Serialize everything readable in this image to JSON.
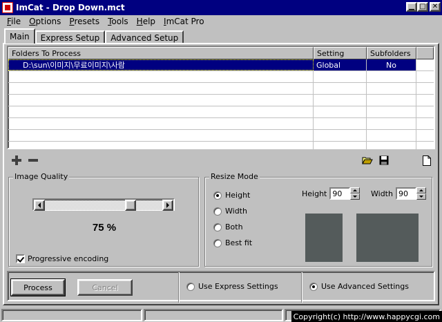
{
  "window": {
    "title": "ImCat - Drop Down.mct"
  },
  "menu": [
    {
      "label": "File",
      "underline": "F",
      "rest": "ile"
    },
    {
      "label": "Options",
      "underline": "O",
      "rest": "ptions"
    },
    {
      "label": "Presets",
      "underline": "P",
      "rest": "resets"
    },
    {
      "label": "Tools",
      "underline": "T",
      "rest": "ools"
    },
    {
      "label": "Help",
      "underline": "H",
      "rest": "elp"
    },
    {
      "label": "ImCat Pro",
      "underline": "I",
      "rest": "mCat Pro"
    }
  ],
  "tabs": [
    {
      "label": "Main",
      "active": true
    },
    {
      "label": "Express Setup",
      "active": false
    },
    {
      "label": "Advanced Setup",
      "active": false
    }
  ],
  "folders": {
    "columns": [
      "Folders To Process",
      "Setting",
      "Subfolders"
    ],
    "rows": [
      {
        "folder": "D:\\sun\\이미지\\무료이미지\\사람",
        "setting": "Global",
        "subfolders": "No",
        "selected": true
      }
    ]
  },
  "image_quality": {
    "title": "Image Quality",
    "value": 75,
    "value_label": "75 %",
    "progressive_label": "Progressive encoding",
    "progressive_checked": true
  },
  "resize": {
    "title": "Resize Mode",
    "options": [
      {
        "label": "Height",
        "selected": true
      },
      {
        "label": "Width",
        "selected": false
      },
      {
        "label": "Both",
        "selected": false
      },
      {
        "label": "Best fit",
        "selected": false
      }
    ],
    "height_label": "Height",
    "height_value": "90",
    "width_label": "Width",
    "width_value": "90"
  },
  "bottom": {
    "process_label": "Process",
    "process_underline": "r",
    "cancel_label": "Cancel",
    "express_label": "Use Express Settings",
    "express_selected": false,
    "advanced_label": "Use Advanced Settings",
    "advanced_selected": true
  },
  "watermark": "Copyright(c) http://www.happycgi.com",
  "colors": {
    "titlebar": "#000080",
    "face": "#c0c0c0",
    "preview": "#545b5b",
    "selection": "#000080"
  }
}
